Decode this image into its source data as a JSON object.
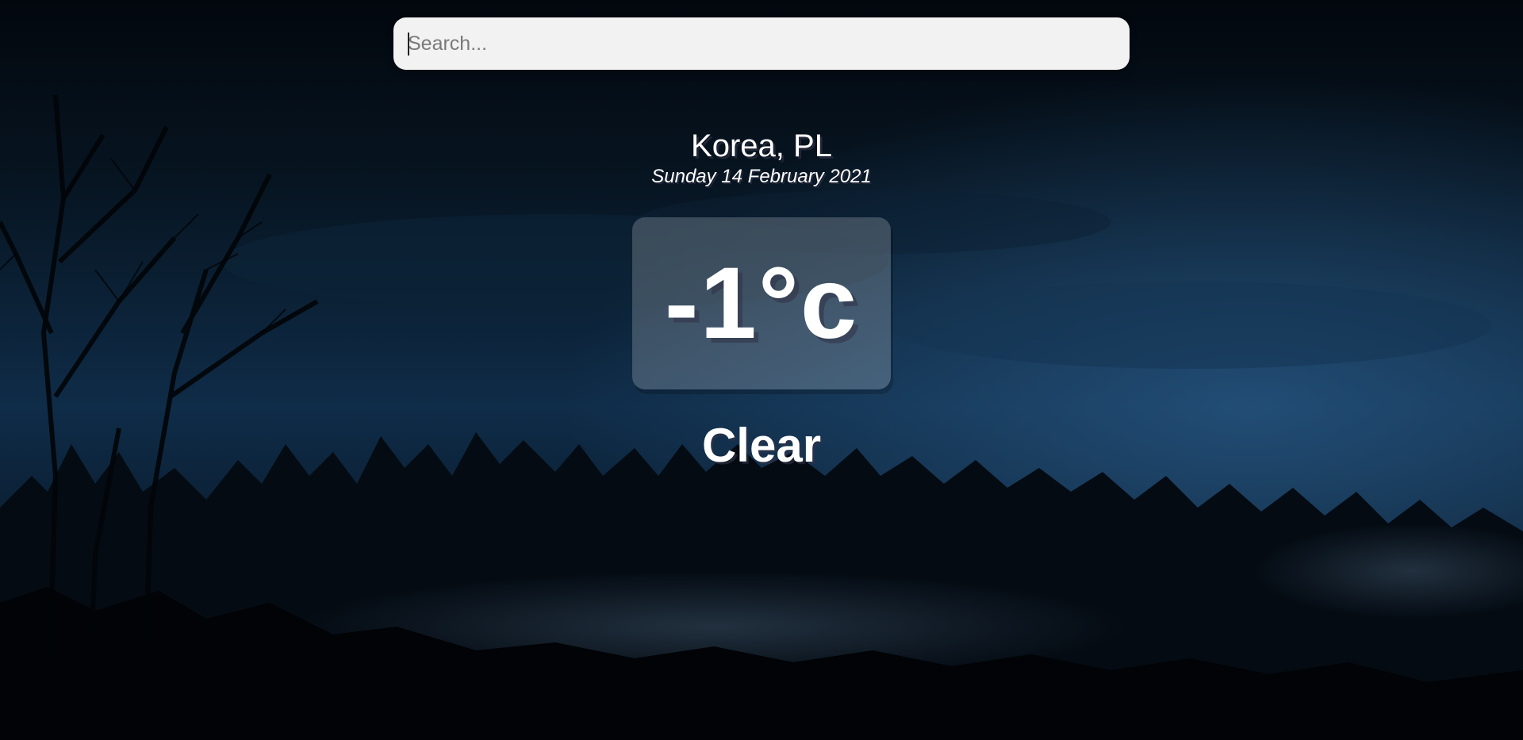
{
  "search": {
    "placeholder": "Search...",
    "value": ""
  },
  "location": {
    "name": "Korea, PL",
    "date": "Sunday 14 February 2021"
  },
  "weather": {
    "temperature": "-1°c",
    "condition": "Clear"
  },
  "background": {
    "theme": "night forest with fog",
    "colors": {
      "sky_top": "#02070d",
      "sky_mid": "#0f2c48",
      "sky_glow": "#1d4a73",
      "forest": "#020509"
    }
  }
}
